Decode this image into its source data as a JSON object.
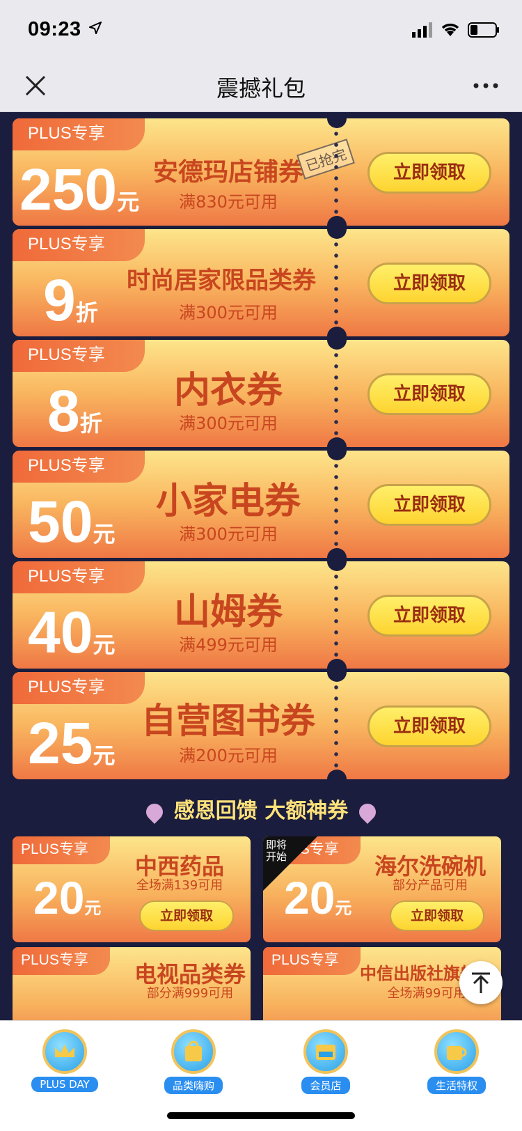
{
  "status": {
    "time": "09:23"
  },
  "nav": {
    "title": "震撼礼包"
  },
  "coupons": [
    {
      "tag": "PLUS专享",
      "amount": "250",
      "unit": "元",
      "title": "安德玛店铺券",
      "condition": "满830元可用",
      "button": "立即领取",
      "stamp": "已抢完"
    },
    {
      "tag": "PLUS专享",
      "amount": "9",
      "unit": "折",
      "title": "时尚居家限品类券",
      "condition": "满300元可用",
      "button": "立即领取"
    },
    {
      "tag": "PLUS专享",
      "amount": "8",
      "unit": "折",
      "title": "内衣券",
      "condition": "满300元可用",
      "button": "立即领取"
    },
    {
      "tag": "PLUS专享",
      "amount": "50",
      "unit": "元",
      "title": "小家电券",
      "condition": "满300元可用",
      "button": "立即领取"
    },
    {
      "tag": "PLUS专享",
      "amount": "40",
      "unit": "元",
      "title": "山姆券",
      "condition": "满499元可用",
      "button": "立即领取"
    },
    {
      "tag": "PLUS专享",
      "amount": "25",
      "unit": "元",
      "title": "自营图书券",
      "condition": "满200元可用",
      "button": "立即领取"
    }
  ],
  "banner": {
    "text": "感恩回馈 大额神券"
  },
  "small_coupons": [
    {
      "tag": "PLUS专享",
      "amount": "20",
      "unit": "元",
      "title": "中西药品",
      "condition": "全场满139可用",
      "button": "立即领取"
    },
    {
      "tag": "PLUS专享",
      "amount": "20",
      "unit": "元",
      "title": "海尔洗碗机",
      "condition": "部分产品可用",
      "button": "立即领取",
      "corner": "即将开始"
    },
    {
      "tag": "PLUS专享",
      "title": "电视品类券",
      "condition": "部分满999可用"
    },
    {
      "tag": "PLUS专享",
      "title": "中信出版社旗舰店",
      "condition": "全场满99可用"
    }
  ],
  "tabs": [
    {
      "label": "PLUS DAY",
      "icon": "crown-icon"
    },
    {
      "label": "品类嗨购",
      "icon": "shopping-bag-icon"
    },
    {
      "label": "会员店",
      "icon": "plus-store-icon"
    },
    {
      "label": "生活特权",
      "icon": "coffee-cup-icon"
    }
  ]
}
